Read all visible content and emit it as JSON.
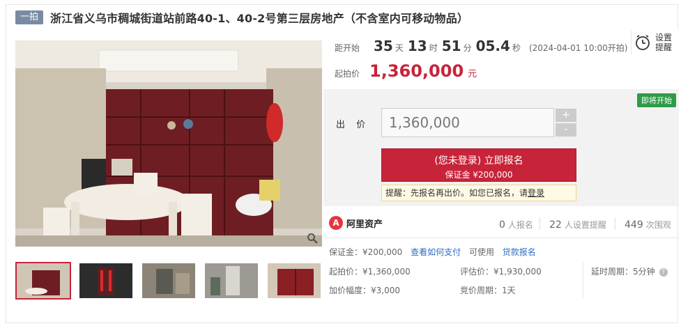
{
  "title": {
    "badge": "一拍",
    "text": "浙江省义乌市稠城街道站前路40-1、40-2号第三层房地产（不含室内可移动物品）"
  },
  "countdown": {
    "label": "距开始",
    "days": "35",
    "days_unit": "天",
    "hours": "13",
    "hours_unit": "时",
    "minutes": "51",
    "minutes_unit": "分",
    "seconds": "05.4",
    "seconds_unit": "秒",
    "start_note": "(2024-04-01 10:00开拍)"
  },
  "start_price": {
    "label": "起拍价",
    "value": "1,360,000",
    "unit": "元"
  },
  "reminder": {
    "line1": "设置",
    "line2": "提醒"
  },
  "bid": {
    "status_tag": "即将开始",
    "label": "出 价",
    "input_value": "1,360,000",
    "plus": "+",
    "minus": "-",
    "signup_line1": "(您未登录) 立即报名",
    "signup_line2": "保证金 ¥200,000",
    "tip_prefix": "提醒：先报名再出价。如您已报名，请",
    "tip_link": "登录"
  },
  "stats": {
    "brand": "阿里资产",
    "brand_mark": "A",
    "signups": "0",
    "signups_unit": "人报名",
    "reminders": "22",
    "reminders_unit": "人设置提醒",
    "watchers": "449",
    "watchers_unit": "次围观"
  },
  "details": {
    "deposit": "保证金：¥200,000",
    "how_to_pay": "查看如何支付",
    "available": "可使用",
    "loan_signup": "贷款报名",
    "start_price": "起拍价：¥1,360,000",
    "appraisal": "评估价：¥1,930,000",
    "delay": "延时周期：5分钟",
    "increment": "加价幅度：¥3,000",
    "bid_cycle": "竞价周期：1天"
  },
  "colors": {
    "accent_red": "#c7243a",
    "status_green": "#2e9c47",
    "link_blue": "#2d6ec0"
  }
}
